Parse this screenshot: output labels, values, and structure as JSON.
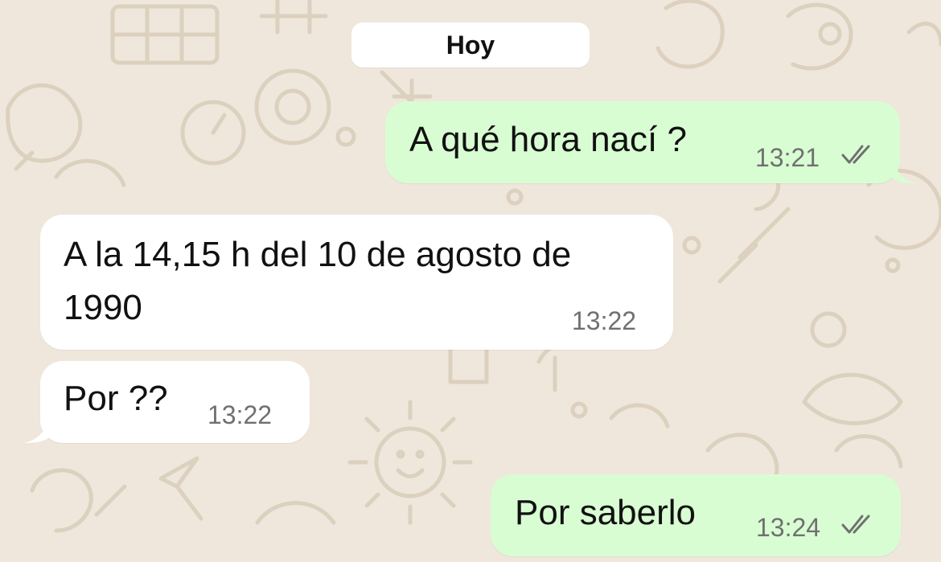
{
  "chat": {
    "date_label": "Hoy",
    "messages": [
      {
        "direction": "outgoing",
        "text": "A qué hora nací ?",
        "time": "13:21",
        "status_icon": "double-check-icon"
      },
      {
        "direction": "incoming",
        "text_lines": [
          "A la 14,15 h del 10 de agosto de",
          "1990"
        ],
        "time": "13:22"
      },
      {
        "direction": "incoming",
        "text": "Por ??",
        "time": "13:22"
      },
      {
        "direction": "outgoing",
        "text": "Por saberlo",
        "time": "13:24",
        "status_icon": "double-check-icon"
      }
    ]
  },
  "colors": {
    "wallpaper": "#efe7dc",
    "outgoing_bubble": "#d9fdd3",
    "incoming_bubble": "#ffffff",
    "text": "#111111",
    "time": "#707070",
    "read_ticks": "#707070"
  }
}
